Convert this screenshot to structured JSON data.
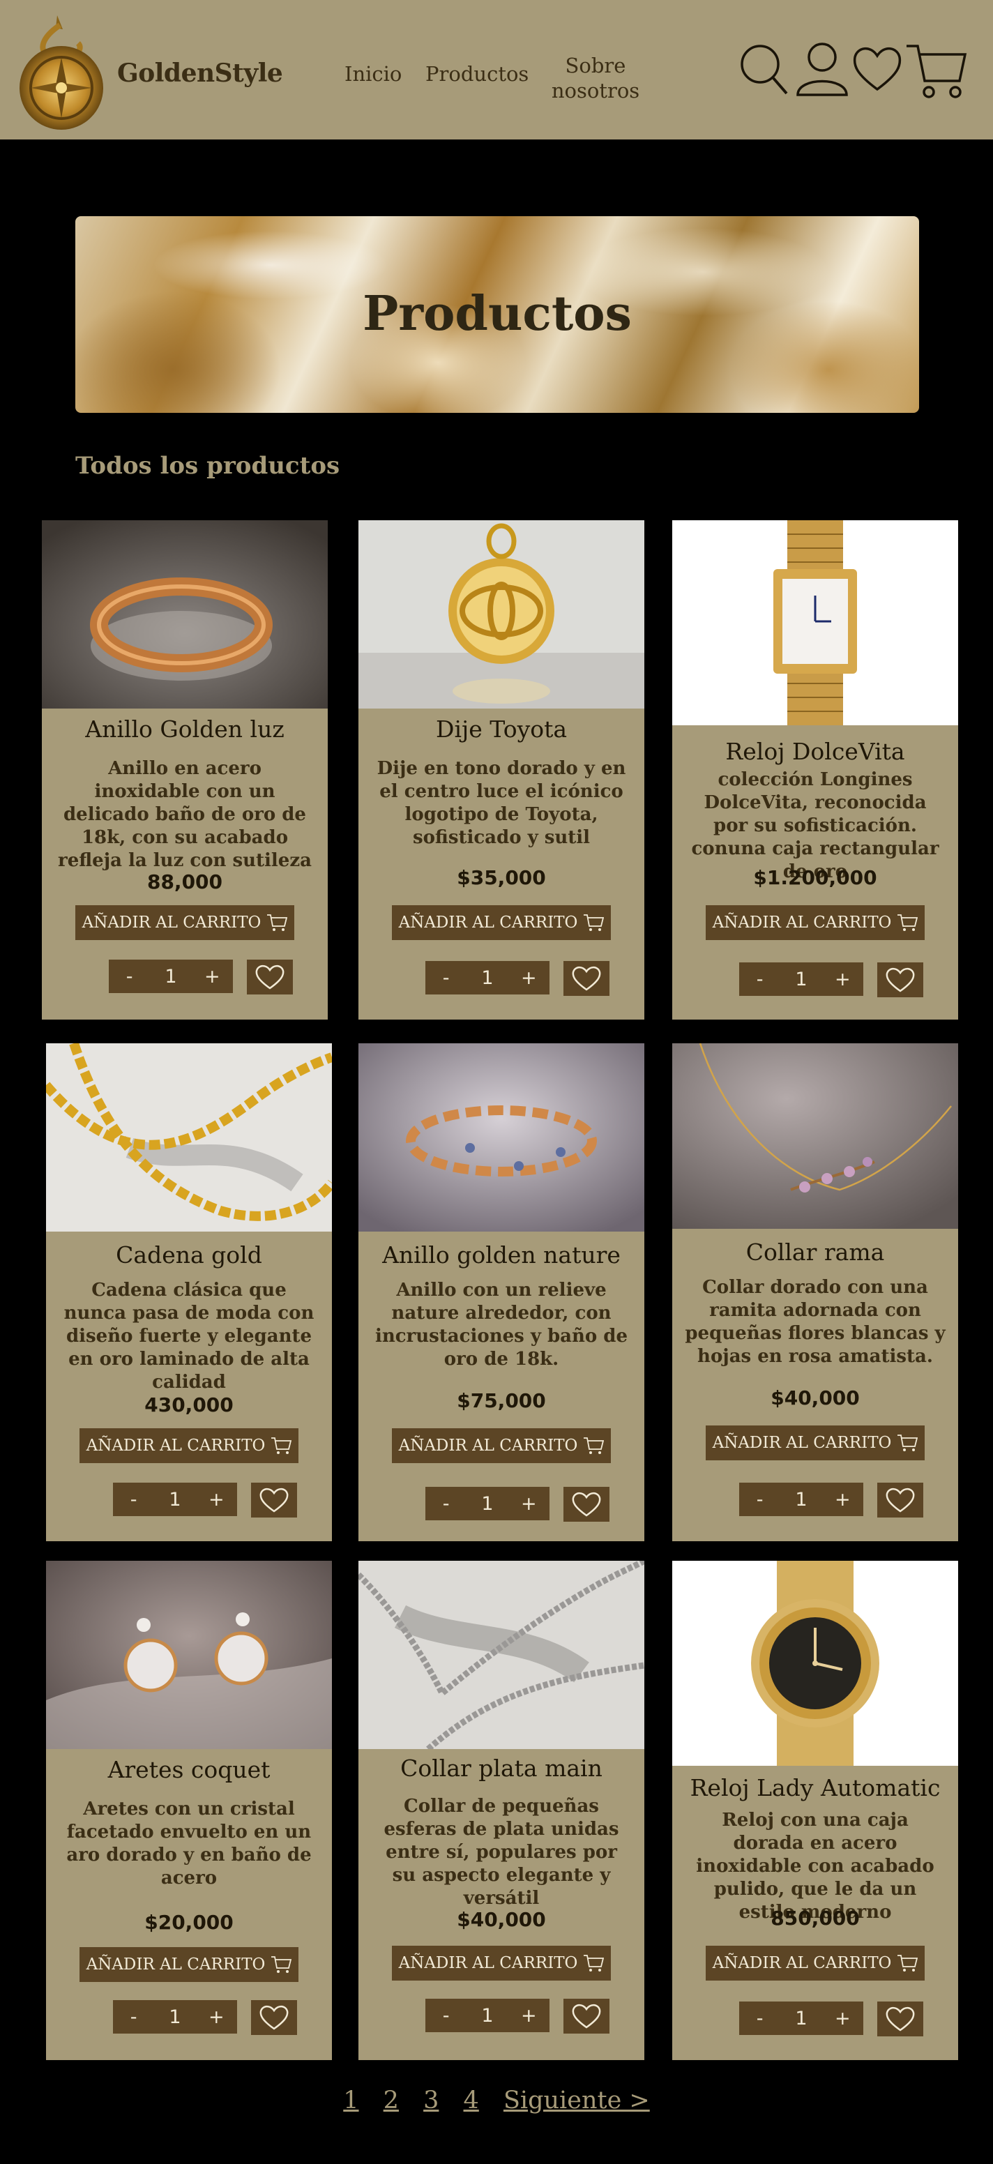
{
  "header": {
    "brand": "GoldenStyle",
    "nav": [
      "Inicio",
      "Productos",
      "Sobre nosotros"
    ],
    "icons": [
      "search-icon",
      "user-icon",
      "heart-icon",
      "cart-icon"
    ]
  },
  "banner": {
    "title": "Productos"
  },
  "section_title": "Todos los productos",
  "products": [
    {
      "name": "Anillo Golden luz",
      "description": "Anillo en acero inoxidable con un delicado baño de oro de 18k, con su acabado refleja la luz con sutileza",
      "price": "88,000",
      "add_label": "AÑADIR AL CARRITO",
      "qty": "1"
    },
    {
      "name": "Dije Toyota",
      "description": "Dije en tono dorado y en el centro luce el icónico logotipo de Toyota, sofisticado y sutil",
      "price": "$35,000",
      "add_label": "AÑADIR AL CARRITO",
      "qty": "1"
    },
    {
      "name": "Reloj DolceVita",
      "description": "colección Longines DolceVita, reconocida por su sofisticación. conuna caja rectangular de oro",
      "price": "$1.200,000",
      "add_label": "AÑADIR AL CARRITO",
      "qty": "1"
    },
    {
      "name": "Cadena gold",
      "description": "Cadena clásica que nunca pasa de moda con diseño fuerte y elegante en oro laminado de alta calidad",
      "price": "430,000",
      "add_label": "AÑADIR AL CARRITO",
      "qty": "1"
    },
    {
      "name": "Anillo golden nature",
      "description": "Anillo con un relieve nature alrededor, con incrustaciones y baño de oro de 18k.",
      "price": "$75,000",
      "add_label": "AÑADIR AL CARRITO",
      "qty": "1"
    },
    {
      "name": "Collar rama",
      "description": "Collar dorado con una ramita adornada con pequeñas flores blancas y hojas en rosa amatista.",
      "price": "$40,000",
      "add_label": "AÑADIR AL CARRITO",
      "qty": "1"
    },
    {
      "name": "Aretes coquet",
      "description": "Aretes con un cristal facetado envuelto en un aro dorado y en baño de acero",
      "price": "$20,000",
      "add_label": "AÑADIR AL CARRITO",
      "qty": "1"
    },
    {
      "name": "Collar plata main",
      "description": "Collar de pequeñas esferas de plata unidas entre sí, populares por su aspecto elegante y versátil",
      "price": "$40,000",
      "add_label": "AÑADIR AL CARRITO",
      "qty": "1"
    },
    {
      "name": "Reloj Lady Automatic",
      "description": "Reloj con una caja dorada en acero inoxidable con acabado pulido, que le da un estilo moderno",
      "price": "850,000",
      "add_label": "AÑADIR AL CARRITO",
      "qty": "1"
    }
  ],
  "stepper": {
    "minus": "-",
    "plus": "+"
  },
  "pagination": [
    "1",
    "2",
    "3",
    "4",
    "Siguiente >"
  ]
}
